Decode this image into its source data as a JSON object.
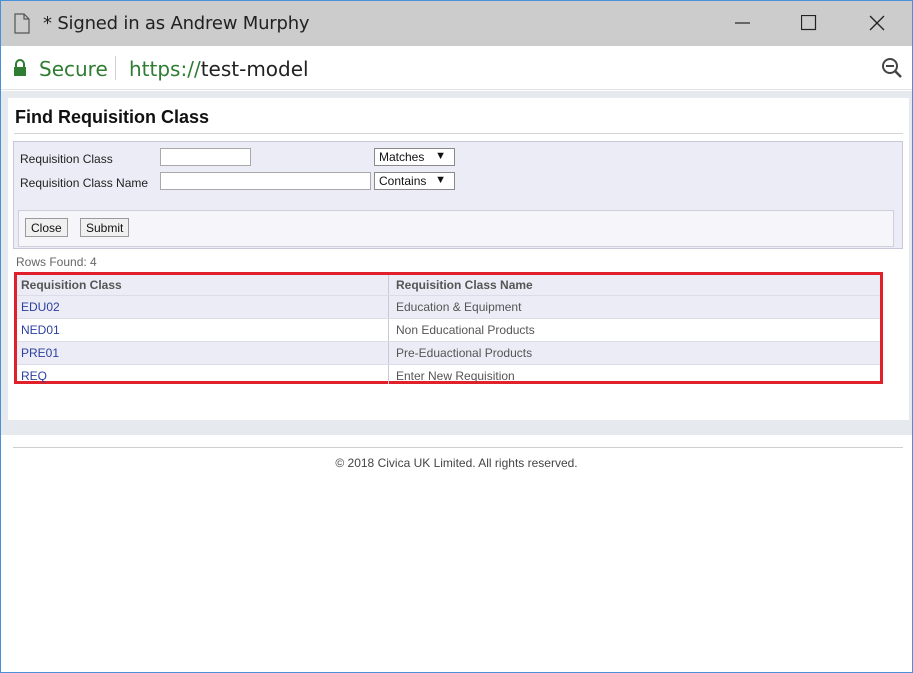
{
  "window": {
    "title": "* Signed in as Andrew Murphy",
    "icons": {
      "doc": "document-icon",
      "min": "minimize-icon",
      "max": "maximize-icon",
      "close": "close-icon"
    }
  },
  "addressbar": {
    "secure_label": "Secure",
    "url_scheme": "https://",
    "url_host": "test-model",
    "icons": {
      "lock": "lock-icon",
      "zoom": "zoom-out-icon"
    }
  },
  "page": {
    "heading": "Find Requisition Class",
    "form": {
      "fields": [
        {
          "label": "Requisition Class",
          "value": "",
          "operator": "Matches"
        },
        {
          "label": "Requisition Class Name",
          "value": "",
          "operator": "Contains"
        }
      ],
      "close_label": "Close",
      "submit_label": "Submit"
    },
    "rows_found": "Rows Found: 4",
    "table": {
      "columns": [
        "Requisition Class",
        "Requisition Class Name"
      ],
      "rows": [
        {
          "code": "EDU02",
          "name": "Education & Equipment"
        },
        {
          "code": "NED01",
          "name": "Non Educational Products"
        },
        {
          "code": "PRE01",
          "name": "Pre-Eduactional Products"
        },
        {
          "code": "REQ",
          "name": "Enter New Requisition"
        }
      ]
    },
    "footer": "© 2018 Civica UK Limited. All rights reserved."
  },
  "colors": {
    "highlight": "#e0202a",
    "secure_green": "#2e7d32",
    "link": "#2a3f9e",
    "row_alt": "#ececf6"
  }
}
